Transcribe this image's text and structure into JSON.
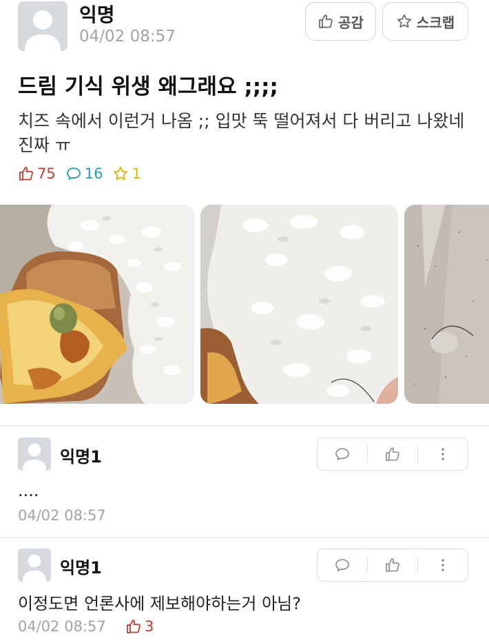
{
  "post": {
    "author": "익명",
    "time": "04/02 08:57",
    "like_button": "공감",
    "scrap_button": "스크랩",
    "title": "드림 기식 위생 왜그래요 ;;;;",
    "body": "치즈 속에서 이런거 나옴 ;; 입맛 뚝 떨어져서 다 버리고 나왔네 진짜 ㅠ",
    "stats": {
      "likes": "75",
      "comments": "16",
      "scraps": "1"
    },
    "images": [
      "pizza-toast-and-rice-photo",
      "rice-with-hair-photo",
      "tray-with-hair-photo"
    ]
  },
  "comments": [
    {
      "author": "익명1",
      "text": "....",
      "time": "04/02 08:57",
      "likes": ""
    },
    {
      "author": "익명1",
      "text": "이정도면 언론사에 제보해야하는거 아님?",
      "time": "04/02 08:57",
      "likes": "3"
    }
  ],
  "icons": {
    "like": "thumbs-up-icon",
    "comment": "speech-bubble-icon",
    "scrap": "star-icon",
    "more": "more-vertical-icon"
  },
  "colors": {
    "like": "#c03d2e",
    "comment": "#2c9bb4",
    "scrap": "#e0b400",
    "meta": "#a3a3a3"
  }
}
